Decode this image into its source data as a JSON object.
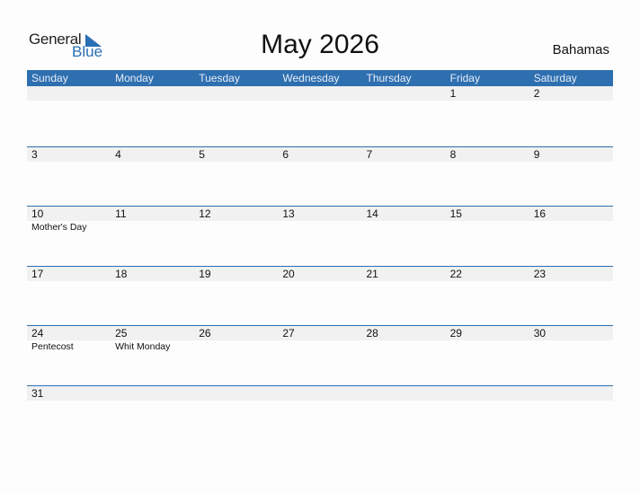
{
  "logo": {
    "general": "General",
    "blue": "Blue"
  },
  "title": "May 2026",
  "country": "Bahamas",
  "accent": "#2e6fb0",
  "days": [
    "Sunday",
    "Monday",
    "Tuesday",
    "Wednesday",
    "Thursday",
    "Friday",
    "Saturday"
  ],
  "weeks": [
    [
      {
        "d": ""
      },
      {
        "d": ""
      },
      {
        "d": ""
      },
      {
        "d": ""
      },
      {
        "d": ""
      },
      {
        "d": "1"
      },
      {
        "d": "2"
      }
    ],
    [
      {
        "d": "3"
      },
      {
        "d": "4"
      },
      {
        "d": "5"
      },
      {
        "d": "6"
      },
      {
        "d": "7"
      },
      {
        "d": "8"
      },
      {
        "d": "9"
      }
    ],
    [
      {
        "d": "10",
        "e": "Mother's Day"
      },
      {
        "d": "11"
      },
      {
        "d": "12"
      },
      {
        "d": "13"
      },
      {
        "d": "14"
      },
      {
        "d": "15"
      },
      {
        "d": "16"
      }
    ],
    [
      {
        "d": "17"
      },
      {
        "d": "18"
      },
      {
        "d": "19"
      },
      {
        "d": "20"
      },
      {
        "d": "21"
      },
      {
        "d": "22"
      },
      {
        "d": "23"
      }
    ],
    [
      {
        "d": "24",
        "e": "Pentecost"
      },
      {
        "d": "25",
        "e": "Whit Monday"
      },
      {
        "d": "26"
      },
      {
        "d": "27"
      },
      {
        "d": "28"
      },
      {
        "d": "29"
      },
      {
        "d": "30"
      }
    ],
    [
      {
        "d": "31"
      },
      {
        "d": ""
      },
      {
        "d": ""
      },
      {
        "d": ""
      },
      {
        "d": ""
      },
      {
        "d": ""
      },
      {
        "d": ""
      }
    ]
  ]
}
